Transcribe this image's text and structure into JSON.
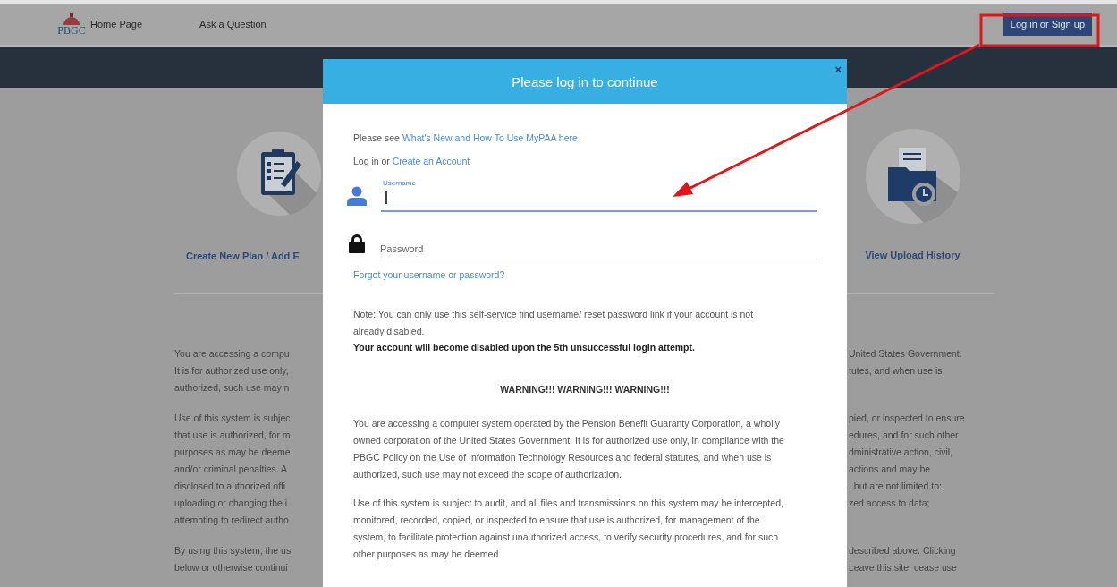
{
  "header": {
    "logo": "PBGC",
    "nav": [
      {
        "label": "Home Page"
      },
      {
        "label": "Ask a Question"
      }
    ],
    "login_button": "Log in or Sign up"
  },
  "tiles": [
    {
      "label": "Create New Plan / Add E",
      "kind": "clipboard"
    },
    {
      "label": "View Upload History",
      "kind": "folder"
    }
  ],
  "notice": [
    {
      "lines": [
        {
          "left": "You are accessing a compu",
          "right": "United States Government."
        },
        {
          "left": "It is for authorized use only,",
          "right": "tutes, and when use is"
        },
        {
          "left": "authorized, such use may n"
        }
      ]
    },
    {
      "lines": [
        {
          "left": "Use of this system is subjec",
          "right": "pied, or inspected to ensure"
        },
        {
          "left": "that use is authorized, for m",
          "right": "edures, and for such other"
        },
        {
          "left": "purposes as may be deeme",
          "right": "dministrative action, civil,"
        },
        {
          "left": "and/or criminal penalties. A",
          "right": "actions and may be"
        },
        {
          "left": "disclosed to authorized offi",
          "right": ", but are not limited to:"
        },
        {
          "left": "uploading or changing the i",
          "right": "zed access to data;"
        },
        {
          "left": "attempting to redirect autho"
        }
      ]
    },
    {
      "lines": [
        {
          "left": "By using this system, the us",
          "right": "described above. Clicking"
        },
        {
          "left": "below or otherwise continui",
          "right": "Leave this site, cease use"
        }
      ]
    }
  ],
  "dialog": {
    "title": "Please log in to continue",
    "close": "×",
    "intro": [
      {
        "text": "Please see ",
        "link": "What's New and How To Use MyPAA here"
      },
      {
        "text": "Log in or ",
        "link": "Create an Account"
      }
    ],
    "fields": [
      {
        "kind": "username",
        "label": "Username",
        "focused": true
      },
      {
        "kind": "password",
        "placeholder": "Password",
        "focused": false
      }
    ],
    "forgot_link": "Forgot your username or password?",
    "note": "Note: You can only use this self-service find username/ reset password link if your account is not already disabled.",
    "note_bold": "Your account will become disabled upon the 5th unsuccessful login attempt.",
    "warning_title": "WARNING!!! WARNING!!! WARNING!!!",
    "paragraphs": [
      "You are accessing a computer system operated by the Pension Benefit Guaranty Corporation, a wholly owned corporation of the United States Government. It is for authorized use only, in compliance with the PBGC Policy on the Use of Information Technology Resources and federal statutes, and when use is authorized, such use may not exceed the scope of authorization.",
      "Use of this system is subject to audit, and all files and transmissions on this system may be intercepted, monitored, recorded, copied, or inspected to ensure that use is authorized, for management of the system, to facilitate protection against unauthorized access, to verify security procedures, and for such other purposes as may be deemed"
    ]
  }
}
